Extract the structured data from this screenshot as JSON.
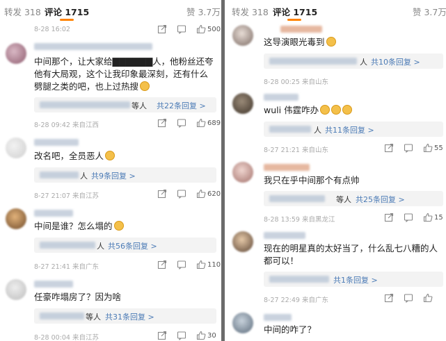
{
  "left": {
    "tabs": {
      "repost": "转发 318",
      "comments": "评论 1715",
      "likes": "赞 3.7万"
    },
    "top_meta": {
      "time": "8-28 16:02",
      "likes": "500"
    },
    "comments": [
      {
        "text": "中间那个，让大家给▇▇▇▇▇▇人，他粉丝还夸他有大局观，这个让我印象最深刻，还有什么劈腿之类的吧，也上过热搜",
        "reply_suffix": "等人",
        "reply_link": "共22条回复 >",
        "time": "8-28 09:42 来自江西",
        "likes": "689"
      },
      {
        "text": "改名吧，全员恶人",
        "reply_suffix": "人",
        "reply_link": "共9条回复 >",
        "time": "8-27 21:07 来自江苏",
        "likes": "620"
      },
      {
        "text": "中间是谁？怎么塌的",
        "reply_suffix": "人",
        "reply_link": "共56条回复 >",
        "time": "8-27 21:41 来自广东",
        "likes": "110"
      },
      {
        "text": "任豪咋塌房了？因为啥",
        "reply_suffix": "等人",
        "reply_link": "共31条回复 >",
        "time": "8-28 00:04 来自江苏",
        "likes": "30"
      }
    ]
  },
  "right": {
    "tabs": {
      "repost": "转发 318",
      "comments": "评论 1715",
      "likes": "赞 3.7万"
    },
    "comments": [
      {
        "text": "这导演眼光毒到",
        "reply_suffix": "人",
        "reply_link": "共10条回复 >",
        "time": "8-28 00:25 来自山东",
        "likes": ""
      },
      {
        "text": "wuli 伟霆咋办",
        "reply_suffix": "人",
        "reply_link": "共11条回复 >",
        "time": "8-27 21:21 来自山东",
        "likes": "55"
      },
      {
        "text": "我只在乎中间那个有点帅",
        "reply_suffix": "等人",
        "reply_link": "共25条回复 >",
        "time": "8-28 13:59 来自黑龙江",
        "likes": "15"
      },
      {
        "text": "现在的明星真的太好当了，什么乱七八糟的人都可以！",
        "reply_suffix": "",
        "reply_link": "共1条回复 >",
        "time": "8-27 22:49 来自广东",
        "likes": ""
      },
      {
        "text": "中间的咋了？",
        "reply_suffix": "",
        "reply_link": "",
        "time": "",
        "likes": ""
      }
    ]
  },
  "colors": {
    "accent": "#ff8200",
    "link": "#4a7ab5",
    "divider": "#6b6b6b"
  }
}
